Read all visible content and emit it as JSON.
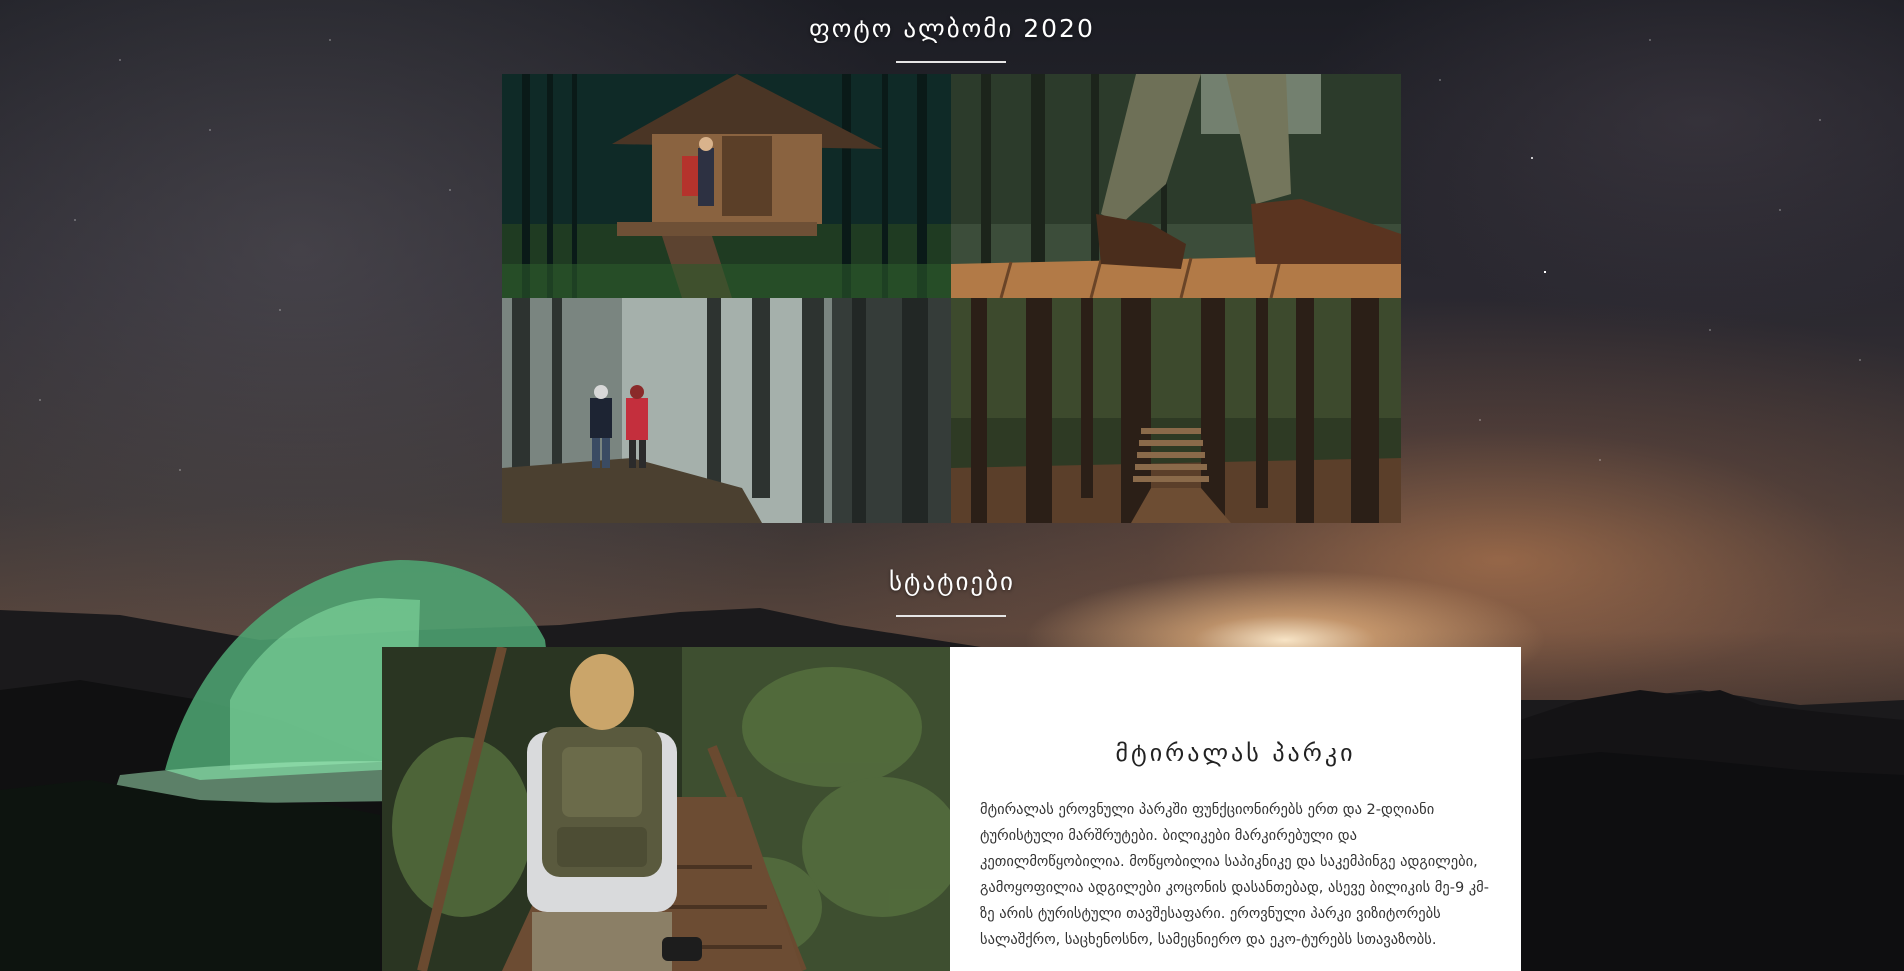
{
  "album": {
    "title": "ფოტო ალბომი 2020",
    "photos": [
      {
        "name": "forest-cabin-photo"
      },
      {
        "name": "hiker-boots-boardwalk-photo"
      },
      {
        "name": "couple-walking-foggy-forest-photo"
      },
      {
        "name": "forest-wooden-stairs-photo"
      }
    ]
  },
  "articles": {
    "title": "სტატიები",
    "items": [
      {
        "image": "hiker-backpack-bridge-photo",
        "title": "მტირალას პარკი",
        "body": "მტირალას ეროვნული პარკში ფუნქციონირებს ერთ და 2-დღიანი ტურისტული მარშრუტები. ბილიკები მარკირებული და კეთილმოწყობილია. მოწყობილია საპიკნიკე და საკემპინგე ადგილები, გამოყოფილია ადგილები კოცონის დასანთებად, ასევე ბილიკის მე-9 კმ-ზე არის ტურისტული თავშესაფარი. ეროვნული პარკი ვიზიტორებს სალაშქრო, საცხენოსნო, სამეცნიერო და ეკო-ტურებს სთავაზობს."
      }
    ]
  },
  "colors": {
    "heading": "#ffffff",
    "card_background": "#ffffff",
    "card_text": "#333333",
    "tent_glow": "#6fcf97"
  }
}
